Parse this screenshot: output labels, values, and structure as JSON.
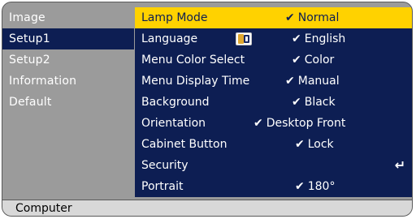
{
  "sidebar": {
    "items": [
      {
        "label": "Image"
      },
      {
        "label": "Setup1"
      },
      {
        "label": "Setup2"
      },
      {
        "label": "Information"
      },
      {
        "label": "Default"
      }
    ]
  },
  "menu": {
    "rows": [
      {
        "label": "Lamp Mode",
        "check": "✔",
        "value": "Normal"
      },
      {
        "label": "Language",
        "check": "✔",
        "value": "English"
      },
      {
        "label": "Menu Color Select",
        "check": "✔",
        "value": "Color"
      },
      {
        "label": "Menu Display Time",
        "check": "✔",
        "value": "Manual"
      },
      {
        "label": "Background",
        "check": "✔",
        "value": "Black"
      },
      {
        "label": "Orientation",
        "check": "✔",
        "value": "Desktop Front"
      },
      {
        "label": "Cabinet Button",
        "check": "✔",
        "value": "Lock"
      },
      {
        "label": "Security",
        "enter": "↵"
      },
      {
        "label": "Portrait",
        "check": "✔",
        "value": "180°"
      }
    ],
    "selected_row": "Lamp Mode"
  },
  "footer": {
    "source_label": "Computer"
  },
  "icons": {
    "language": "language-icon",
    "enter": "enter-icon",
    "check": "checkmark-icon"
  },
  "colors": {
    "panel_bg": "#0d1e53",
    "highlight": "#ffd200",
    "sidebar_bg": "#9b9b9b",
    "footer_bg": "#d8d8d8"
  }
}
